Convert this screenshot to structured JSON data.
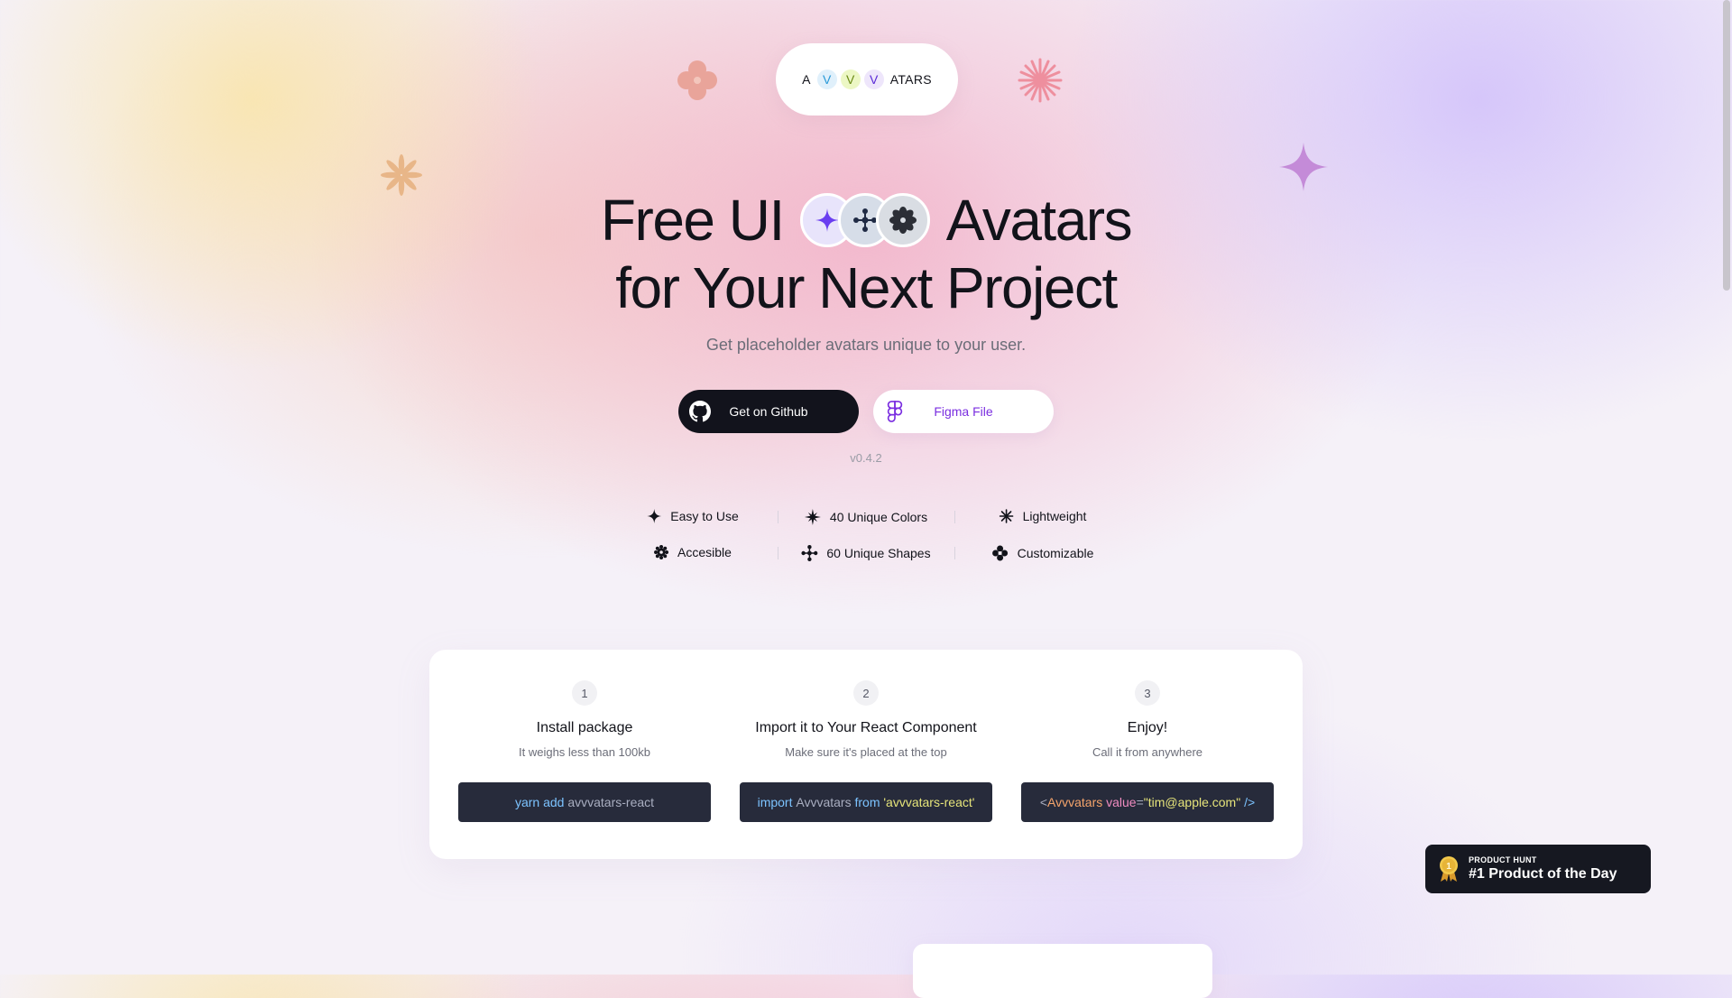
{
  "logo": {
    "a": "A",
    "v1": "V",
    "v2": "V",
    "v3": "V",
    "rest": "ATARS"
  },
  "hero": {
    "title_part1": "Free UI",
    "title_part2": "Avatars",
    "title_line2": "for Your Next Project",
    "subtitle": "Get placeholder avatars unique to your user."
  },
  "buttons": {
    "github_label": "Get on Github",
    "figma_label": "Figma File"
  },
  "version": "v0.4.2",
  "features": [
    {
      "label": "Easy to Use",
      "icon": "sparkle-icon"
    },
    {
      "label": "40 Unique Colors",
      "icon": "star-burst-icon"
    },
    {
      "label": "Lightweight",
      "icon": "asterisk-icon"
    },
    {
      "label": "Accesible",
      "icon": "gear-flower-icon"
    },
    {
      "label": "60 Unique Shapes",
      "icon": "network-icon"
    },
    {
      "label": "Customizable",
      "icon": "clover-icon"
    }
  ],
  "steps": [
    {
      "number": "1",
      "title": "Install package",
      "desc": "It weighs less than 100kb",
      "code": {
        "kw": "yarn add",
        "plain": "avvvatars-react"
      }
    },
    {
      "number": "2",
      "title": "Import it to Your React Component",
      "desc": "Make sure it's placed at the top",
      "code": {
        "kw1": "import",
        "plain": "Avvvatars",
        "kw2": "from",
        "str": "'avvvatars-react'"
      }
    },
    {
      "number": "3",
      "title": "Enjoy!",
      "desc": "Call it from anywhere",
      "code": {
        "open": "<",
        "tag": "Avvvatars",
        "attr": "value",
        "eq": "=",
        "str": "\"tim@apple.com\"",
        "close": "/>"
      }
    }
  ],
  "product_hunt": {
    "small": "PRODUCT HUNT",
    "big": "#1 Product of the Day"
  },
  "colors": {
    "accent_purple": "#7a2ee0",
    "dark": "#12131c",
    "code_bg": "#272b3b"
  }
}
